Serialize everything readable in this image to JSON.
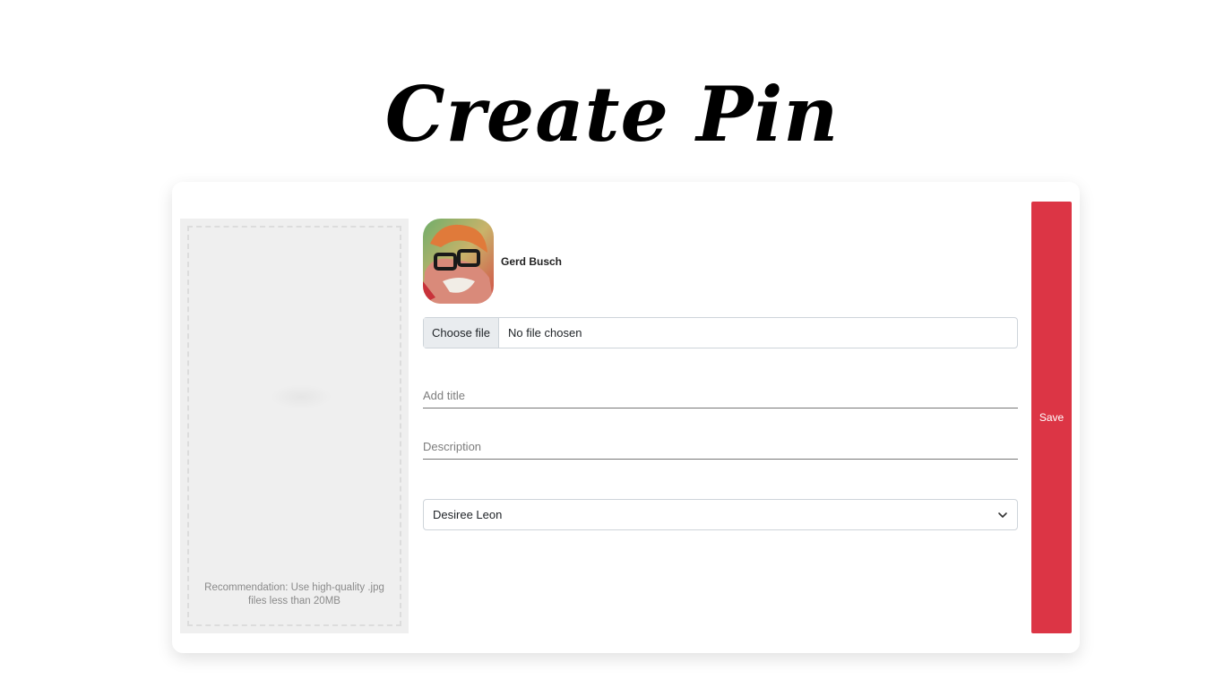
{
  "page": {
    "title": "Create Pin"
  },
  "upload": {
    "hint": "Recommendation: Use high-quality .jpg files less than 20MB",
    "icon": "upload-cloud-icon"
  },
  "user": {
    "name": "Gerd Busch",
    "avatar_icon": "user-avatar"
  },
  "file_input": {
    "button_label": "Choose file",
    "status": "No file chosen"
  },
  "title_input": {
    "placeholder": "Add title",
    "value": ""
  },
  "description_input": {
    "placeholder": "Description",
    "value": ""
  },
  "category_select": {
    "selected": "Desiree Leon",
    "icon": "chevron-down-icon"
  },
  "save_button": {
    "label": "Save",
    "color": "#dc3545"
  }
}
